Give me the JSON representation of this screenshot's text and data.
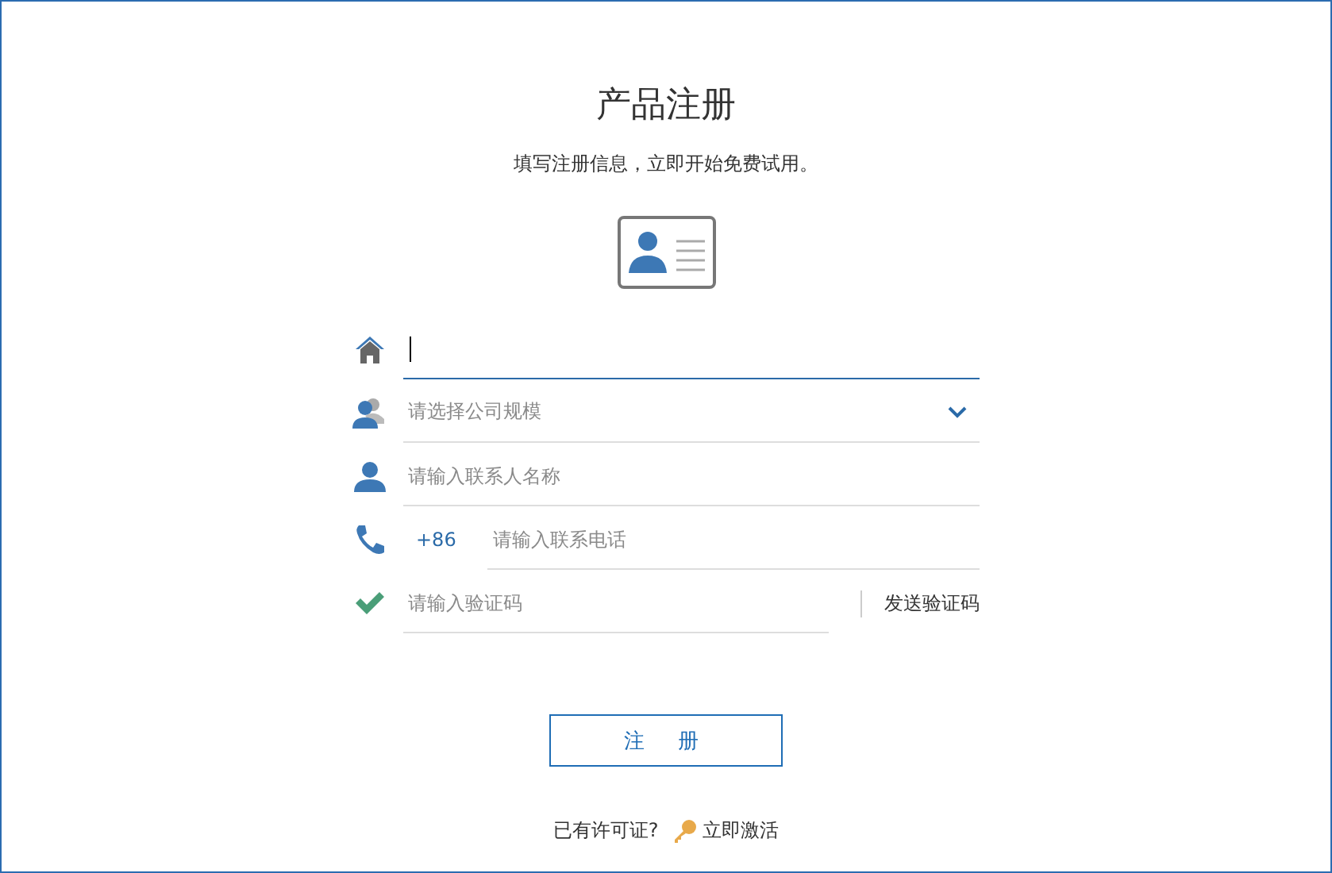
{
  "title": "产品注册",
  "subtitle": "填写注册信息，立即开始免费试用。",
  "fields": [
    {
      "kind": "text",
      "focused": true
    },
    {
      "kind": "select",
      "placeholder": "请选择公司规模",
      "focused": false
    },
    {
      "kind": "text",
      "placeholder": "请输入联系人名称",
      "focused": false
    },
    {
      "kind": "phone",
      "prefix": "+86",
      "placeholder": "请输入联系电话",
      "focused": false
    },
    {
      "kind": "code",
      "placeholder": "请输入验证码",
      "action": "发送验证码",
      "focused": false
    }
  ],
  "submit": "注册",
  "footer": {
    "question": "已有许可证?",
    "link": "立即激活"
  }
}
